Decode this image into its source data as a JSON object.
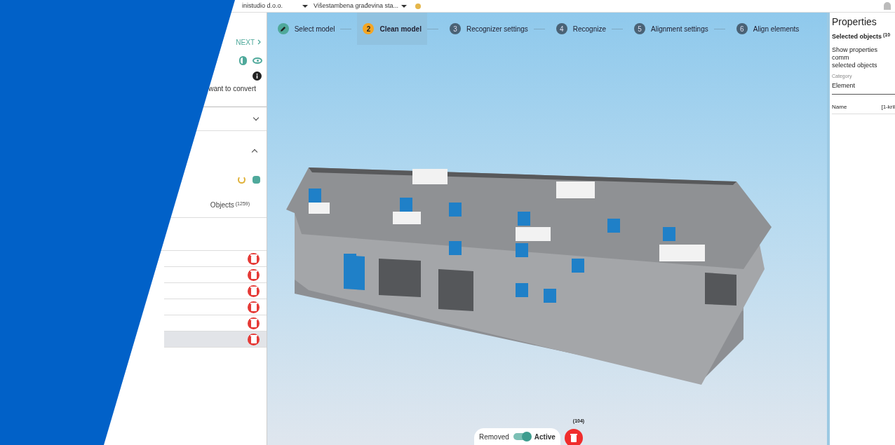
{
  "top_bar": {
    "company": "inistudio d.o.o.",
    "project": "Višestambena građevina sta..."
  },
  "left_panel": {
    "next_label": "NEXT",
    "info_text": "want to convert",
    "objects_label": "Objects",
    "objects_count": "(1259)",
    "rows": [
      {
        "selected": false
      },
      {
        "selected": false
      },
      {
        "selected": false
      },
      {
        "selected": false
      },
      {
        "selected": false
      },
      {
        "selected": true
      }
    ]
  },
  "steps": [
    {
      "kind": "done",
      "label": "Select model",
      "selected": false
    },
    {
      "kind": "current",
      "number": "2",
      "label": "Clean model",
      "selected": true
    },
    {
      "kind": "todo",
      "number": "3",
      "label": "Recognizer settings",
      "selected": false
    },
    {
      "kind": "todo",
      "number": "4",
      "label": "Recognize",
      "selected": false
    },
    {
      "kind": "todo",
      "number": "5",
      "label": "Alignment settings",
      "selected": false
    },
    {
      "kind": "todo",
      "number": "6",
      "label": "Align elements",
      "selected": false
    }
  ],
  "filter": {
    "off_label": "Removed",
    "on_label": "Active",
    "on": true,
    "delete_count": "(104)"
  },
  "properties": {
    "title": "Properties",
    "selected_label": "Selected objects",
    "selected_count": "(10",
    "description": "Show properties comm\nselected objects",
    "category_label": "Category",
    "category_value": "Element",
    "name_label": "Name",
    "name_value": "[1-kril"
  }
}
